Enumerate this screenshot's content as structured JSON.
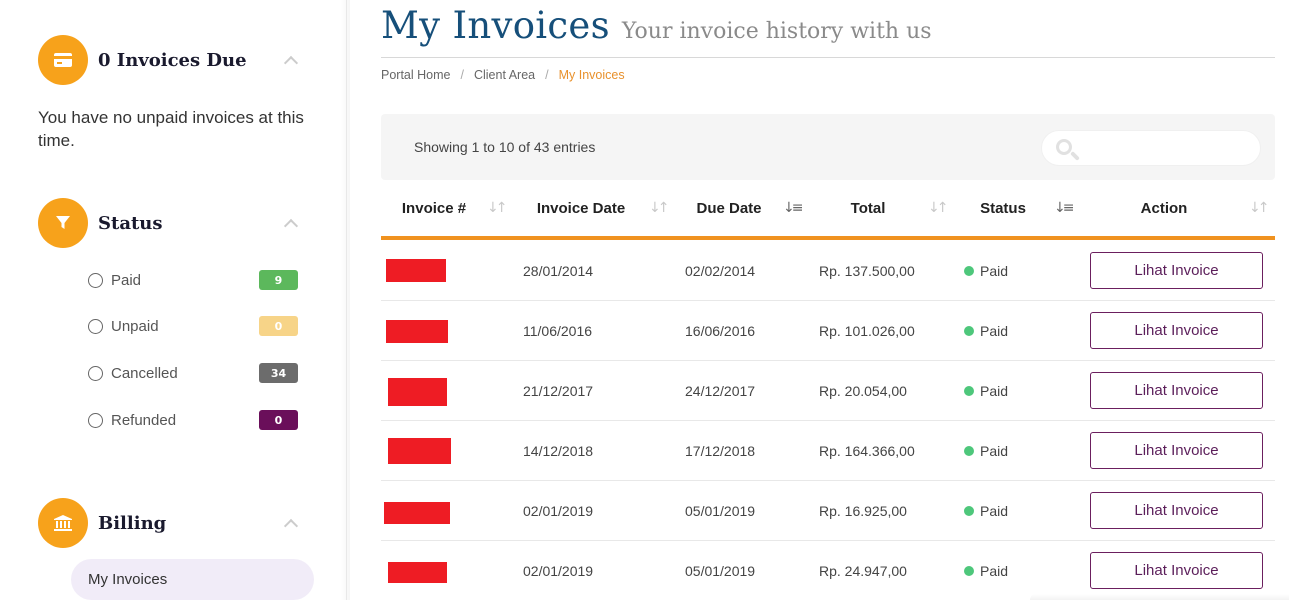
{
  "sidebar": {
    "invoices_due": {
      "title": "0 Invoices Due",
      "message": "You have no unpaid invoices at this time."
    },
    "status": {
      "title": "Status",
      "items": [
        {
          "label": "Paid",
          "count": "9",
          "color": "#5cb85c"
        },
        {
          "label": "Unpaid",
          "count": "0",
          "color": "#f7d488"
        },
        {
          "label": "Cancelled",
          "count": "34",
          "color": "#6c6c6c"
        },
        {
          "label": "Refunded",
          "count": "0",
          "color": "#6a0f5a"
        }
      ]
    },
    "billing": {
      "title": "Billing",
      "active_item": "My Invoices"
    }
  },
  "header": {
    "title": "My Invoices",
    "subtitle": "Your invoice history with us"
  },
  "breadcrumb": [
    "Portal Home",
    "Client Area",
    "My Invoices"
  ],
  "table": {
    "entries_info": "Showing 1 to 10 of 43 entries",
    "search_placeholder": "",
    "columns": [
      "Invoice #",
      "Invoice Date",
      "Due Date",
      "Total",
      "Status",
      "Action"
    ],
    "rows": [
      {
        "invoice_date": "28/01/2014",
        "due_date": "02/02/2014",
        "total": "Rp. 137.500,00",
        "status": "Paid",
        "action": "Lihat Invoice"
      },
      {
        "invoice_date": "11/06/2016",
        "due_date": "16/06/2016",
        "total": "Rp. 101.026,00",
        "status": "Paid",
        "action": "Lihat Invoice"
      },
      {
        "invoice_date": "21/12/2017",
        "due_date": "24/12/2017",
        "total": "Rp. 20.054,00",
        "status": "Paid",
        "action": "Lihat Invoice"
      },
      {
        "invoice_date": "14/12/2018",
        "due_date": "17/12/2018",
        "total": "Rp. 164.366,00",
        "status": "Paid",
        "action": "Lihat Invoice"
      },
      {
        "invoice_date": "02/01/2019",
        "due_date": "05/01/2019",
        "total": "Rp. 16.925,00",
        "status": "Paid",
        "action": "Lihat Invoice"
      },
      {
        "invoice_date": "02/01/2019",
        "due_date": "05/01/2019",
        "total": "Rp. 24.947,00",
        "status": "Paid",
        "action": "Lihat Invoice"
      }
    ]
  },
  "colors": {
    "accent": "#f7a21b",
    "title_blue": "#164f7a",
    "table_rule": "#f0921f",
    "button_border": "#6b1f5e",
    "paid_dot": "#4ec77b",
    "redaction": "#ee1c24"
  }
}
